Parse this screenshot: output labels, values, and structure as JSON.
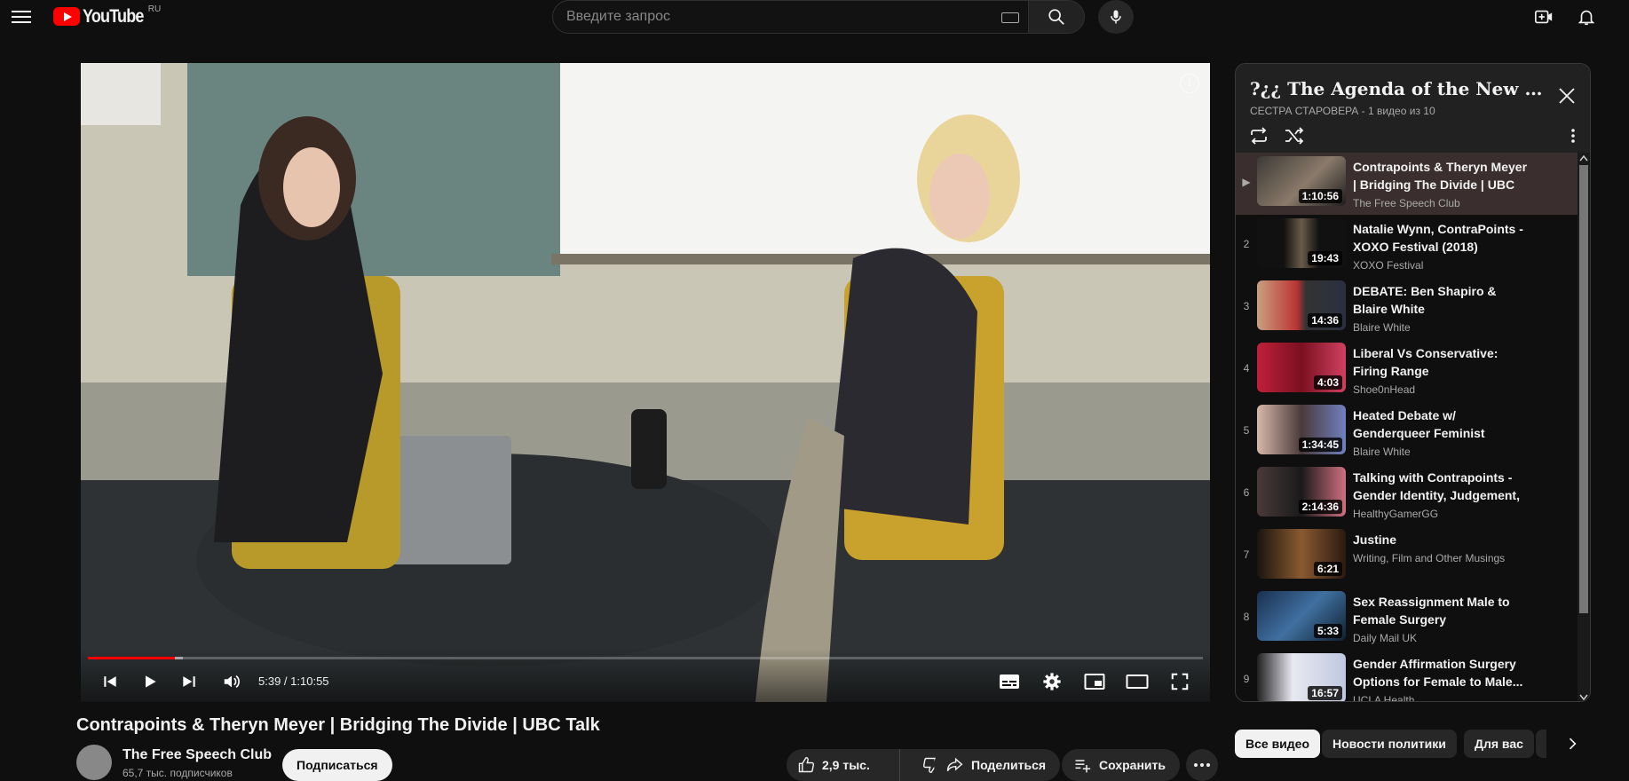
{
  "header": {
    "logo_text": "YouTube",
    "country_code": "RU",
    "search_placeholder": "Введите запрос"
  },
  "player": {
    "time_current": "5:39",
    "time_separator": " / ",
    "time_total": "1:10:55",
    "progress_played": 0.078,
    "progress_buffered": 0.085
  },
  "video": {
    "title": "Contrapoints & Theryn Meyer | Bridging The Divide | UBC Talk",
    "channel": "The Free Speech Club",
    "subscribers": "65,7 тыс. подписчиков",
    "subscribe_label": "Подписаться",
    "likes": "2,9 тыс.",
    "share_label": "Поделиться",
    "save_label": "Сохранить"
  },
  "playlist": {
    "title": "?¿¿ The Agenda of the New Right...",
    "owner": "СЕСТРА СТАРОВЕРА",
    "position": "1 видео из 10",
    "items": [
      {
        "index": "▶",
        "title": "Contrapoints & Theryn Meyer | Bridging The Divide | UBC Talk",
        "channel": "The Free Speech Club",
        "duration": "1:10:56"
      },
      {
        "index": "2",
        "title": "Natalie Wynn, ContraPoints - XOXO Festival (2018)",
        "channel": "XOXO Festival",
        "duration": "19:43"
      },
      {
        "index": "3",
        "title": "DEBATE: Ben Shapiro & Blaire White",
        "channel": "Blaire White",
        "duration": "14:36"
      },
      {
        "index": "4",
        "title": "Liberal Vs Conservative: Firing Range",
        "channel": "Shoe0nHead",
        "duration": "4:03"
      },
      {
        "index": "5",
        "title": "Heated Debate w/ Genderqueer Feminist",
        "channel": "Blaire White",
        "duration": "1:34:45"
      },
      {
        "index": "6",
        "title": "Talking with Contrapoints - Gender Identity, Judgement, ...",
        "channel": "HealthyGamerGG",
        "duration": "2:14:36"
      },
      {
        "index": "7",
        "title": "Justine",
        "channel": "Writing, Film and Other Musings",
        "duration": "6:21"
      },
      {
        "index": "8",
        "title": "Sex Reassignment Male to Female Surgery",
        "channel": "Daily Mail UK",
        "duration": "5:33"
      },
      {
        "index": "9",
        "title": "Gender Affirmation Surgery Options for Female to Male...",
        "channel": "UCLA Health",
        "duration": "16:57"
      }
    ]
  },
  "chips": [
    "Все видео",
    "Новости политики",
    "Для вас"
  ],
  "colors": {
    "accent": "#ff0000",
    "background": "#0f0f0f"
  }
}
